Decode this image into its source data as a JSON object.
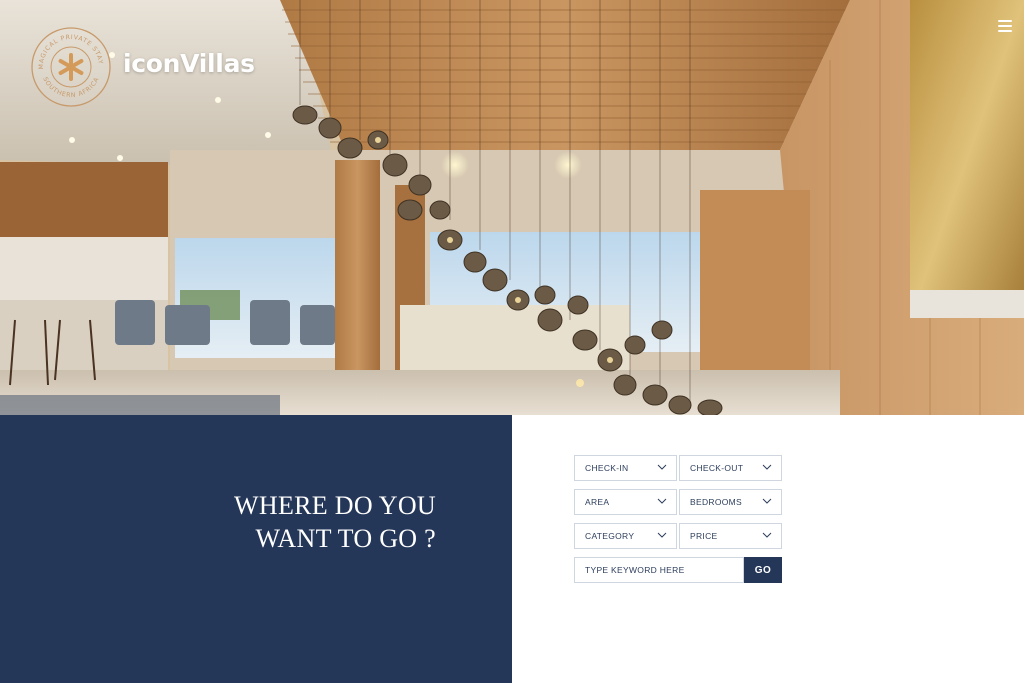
{
  "brand": {
    "name": "iconVillas",
    "logo_ring_text_top": "MAGICAL PRIVATE STAYS",
    "logo_ring_text_bottom": "SOUTHERN AFRICA",
    "accent_color": "#c79a6b"
  },
  "nav": {
    "menu_icon": "hamburger-icon"
  },
  "hero": {
    "alt_description_icon": "villa-interior-photo"
  },
  "headline": {
    "line1": "WHERE DO YOU",
    "line2": "WANT TO GO ?"
  },
  "search": {
    "check_in": "CHECK-IN",
    "check_out": "CHECK-OUT",
    "area": "AREA",
    "bedrooms": "BEDROOMS",
    "category": "CATEGORY",
    "price": "PRICE",
    "keyword_placeholder": "TYPE KEYWORD HERE",
    "go_label": "GO"
  },
  "colors": {
    "navy": "#253758",
    "border": "#cfd6df",
    "text": "#2d3e5c"
  }
}
